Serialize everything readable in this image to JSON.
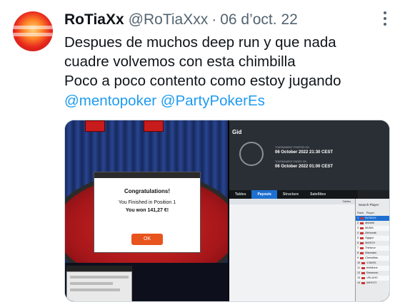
{
  "tweet": {
    "display_name": "RoTiaXx",
    "handle": "@RoTiaXxx",
    "separator": "·",
    "date": "06 d’oct. 22",
    "lines": [
      "Despues de muchos deep run y que nada",
      "cuadre volvemos con esta chimbilla",
      "Poco a poco contento como estoy jugando"
    ],
    "mentions": [
      "@mentopoker",
      "@PartyPokerEs"
    ]
  },
  "media_left": {
    "dialog_title": "Congratulations!",
    "line1": "You Finished in Position 1",
    "line2": "You won 141,27 €!",
    "ok_label": "OK"
  },
  "media_right": {
    "header_title": "Gid",
    "started_label": "TOURNAMENT STARTED ON",
    "started_value": "06 October 2022   21:30 CEST",
    "ended_label": "TOURNAMENT ENDED ON",
    "ended_value": "06 October 2022   01:00 CEST",
    "tabs": [
      "Tables",
      "Payouts",
      "Structure",
      "Satellites"
    ],
    "active_tab": "Payouts",
    "list_header": "Tables",
    "search_label": "Search Player",
    "col_rank": "Rank",
    "col_player": "Player",
    "players": [
      {
        "rank": "1",
        "name": "RoTiAXX"
      },
      {
        "rank": "2",
        "name": "alsinete"
      },
      {
        "rank": "3",
        "name": "MUMA"
      },
      {
        "rank": "4",
        "name": "Alehonak"
      },
      {
        "rank": "5",
        "name": "Ggigue"
      },
      {
        "rank": "6",
        "name": "MASCH"
      },
      {
        "rank": "7",
        "name": "Thinknor"
      },
      {
        "rank": "8",
        "name": "Wannabu"
      },
      {
        "rank": "9",
        "name": "ChessMas"
      },
      {
        "rank": "10",
        "name": "VJAVEL"
      },
      {
        "rank": "11",
        "name": "teleMone"
      },
      {
        "rank": "12",
        "name": "Bresenau"
      },
      {
        "rank": "13",
        "name": "VELAHO"
      },
      {
        "rank": "14",
        "name": "WHYGT"
      }
    ]
  }
}
